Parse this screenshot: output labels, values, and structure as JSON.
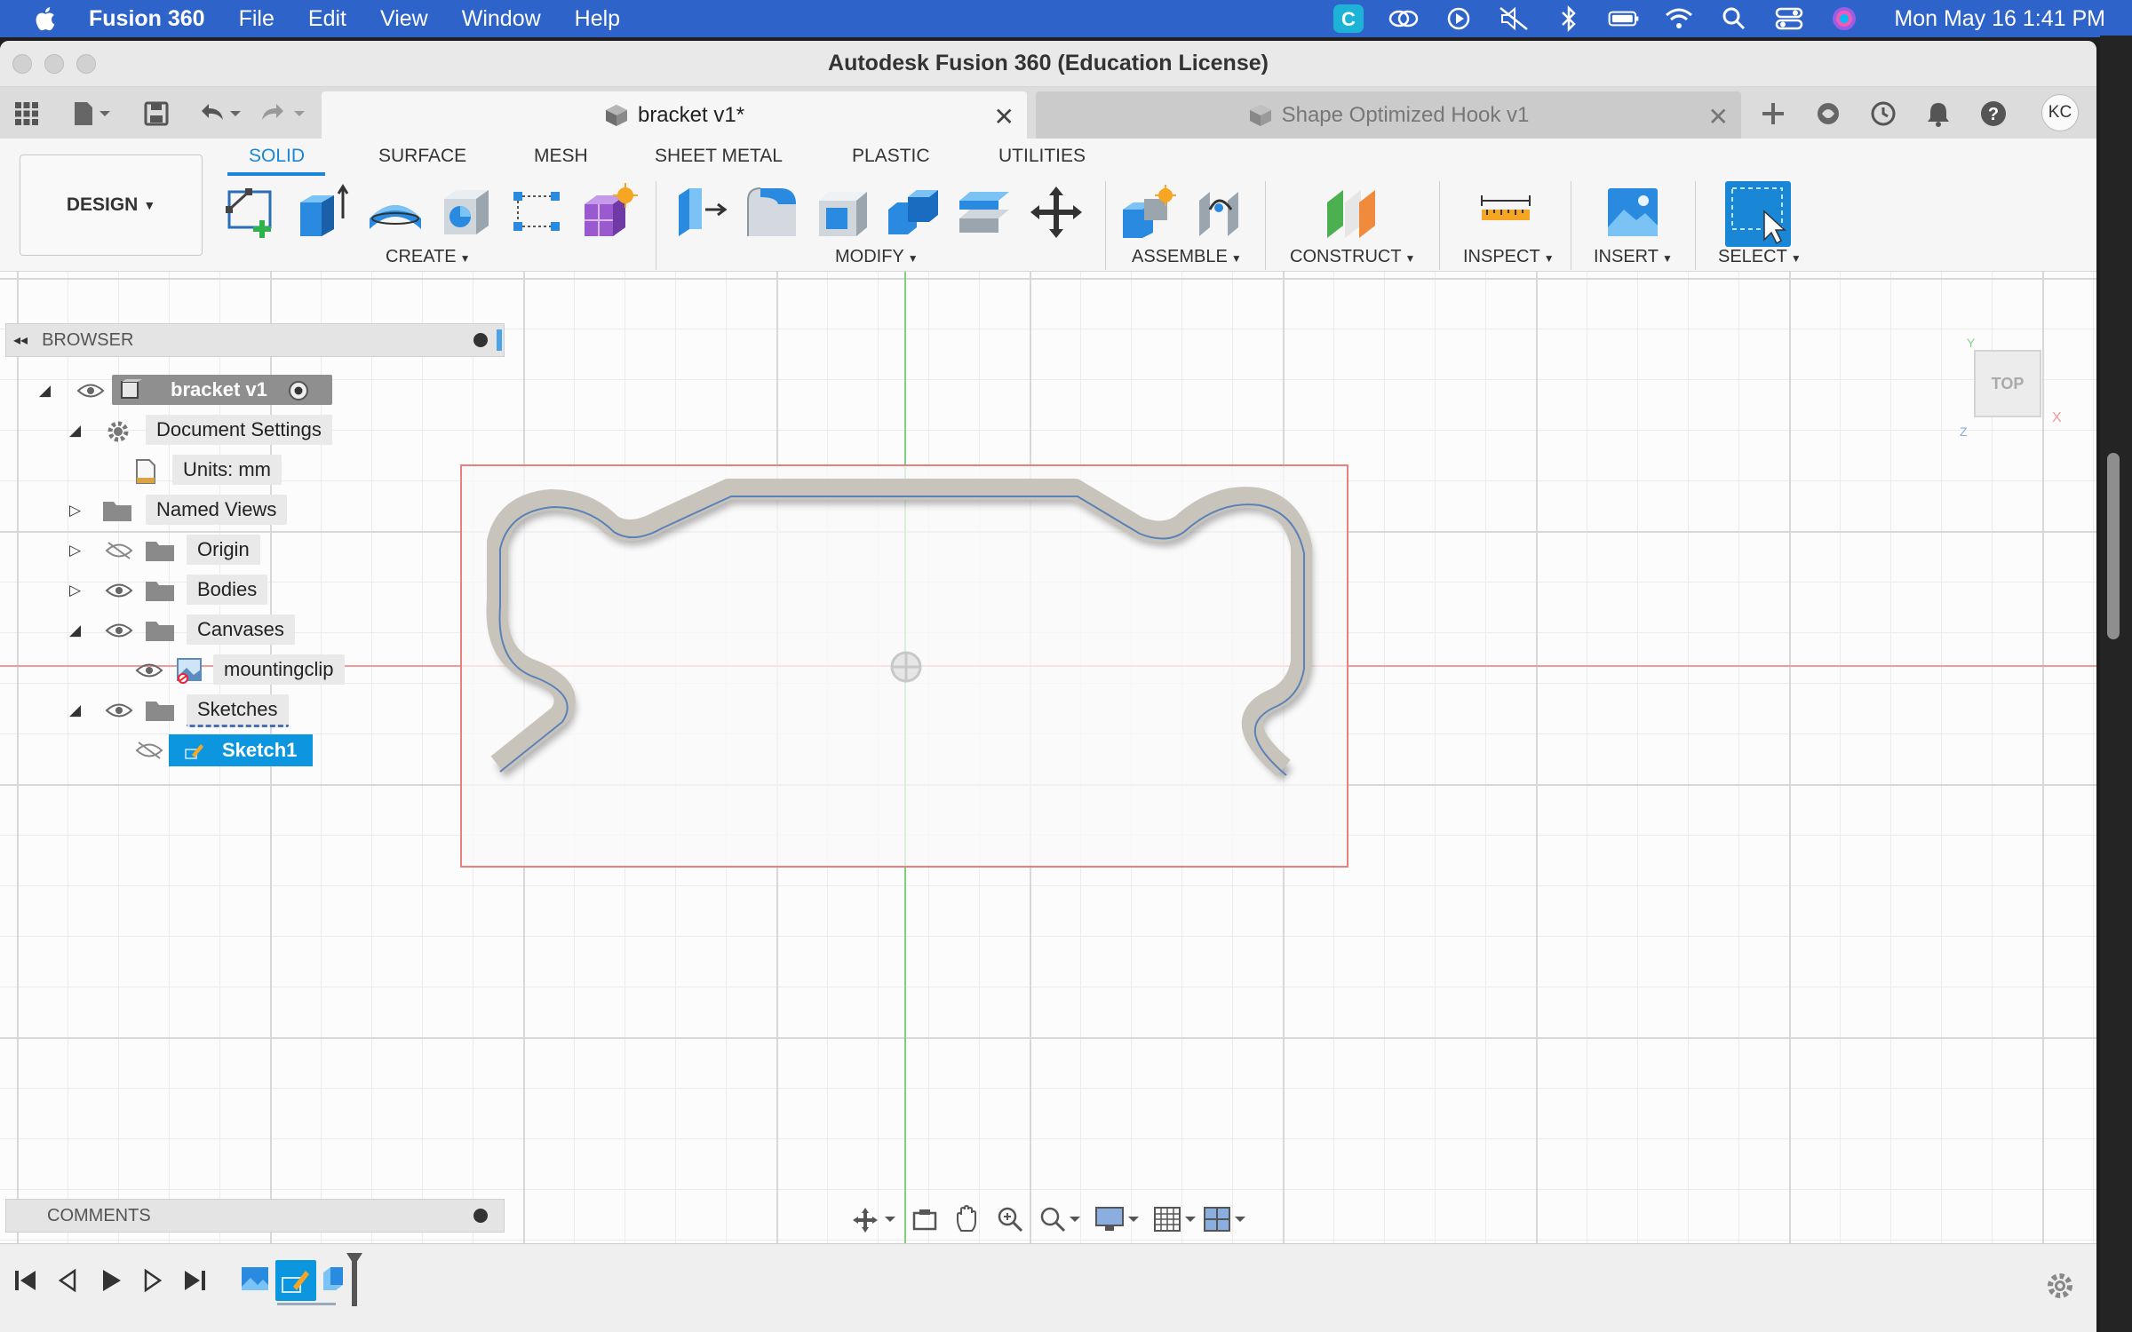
{
  "menubar": {
    "app_name": "Fusion 360",
    "items": [
      "File",
      "Edit",
      "View",
      "Window",
      "Help"
    ],
    "clock": "Mon May 16  1:41 PM"
  },
  "window": {
    "title": "Autodesk Fusion 360 (Education License)"
  },
  "tabs": {
    "active": "bracket v1*",
    "inactive": "Shape Optimized Hook v1"
  },
  "user": {
    "initials": "KC"
  },
  "toolbar": {
    "workspace": "DESIGN",
    "workspace_tabs": [
      "SOLID",
      "SURFACE",
      "MESH",
      "SHEET METAL",
      "PLASTIC",
      "UTILITIES"
    ],
    "groups": [
      "CREATE",
      "MODIFY",
      "ASSEMBLE",
      "CONSTRUCT",
      "INSPECT",
      "INSERT",
      "SELECT"
    ]
  },
  "browser": {
    "title": "BROWSER",
    "root": "bracket v1",
    "document_settings": "Document Settings",
    "units": "Units: mm",
    "named_views": "Named Views",
    "origin": "Origin",
    "bodies": "Bodies",
    "canvases": "Canvases",
    "canvas_item": "mountingclip",
    "sketches": "Sketches",
    "sketch_item": "Sketch1"
  },
  "comments": {
    "title": "COMMENTS"
  },
  "viewcube": {
    "face": "TOP",
    "axis_x": "X",
    "axis_y": "Y",
    "axis_z": "Z"
  },
  "colors": {
    "menubar": "#2e63c9",
    "accent": "#1a87d6",
    "selected_row": "#0d96e0",
    "canvas_border": "#e06060"
  }
}
